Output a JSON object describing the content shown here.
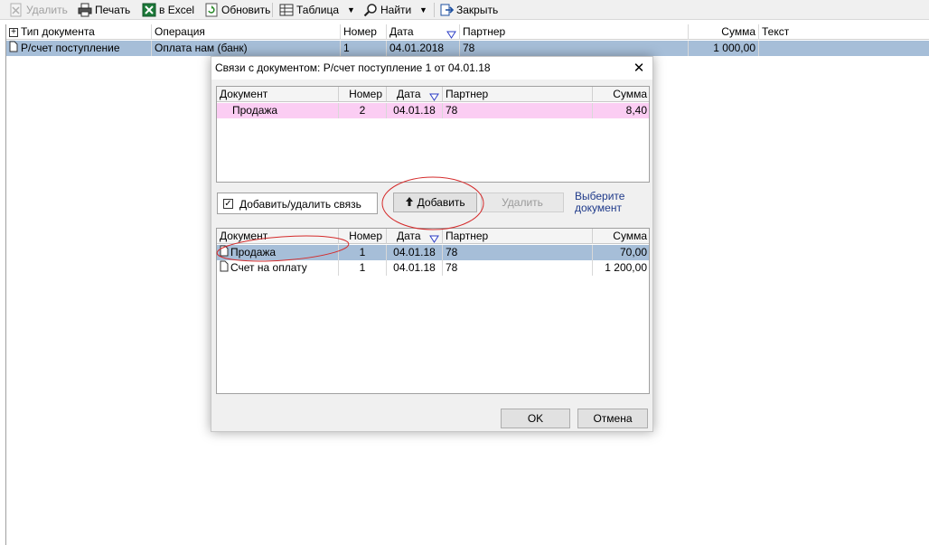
{
  "toolbar": {
    "delete_label": "Удалить",
    "print_label": "Печать",
    "excel_label": "в Excel",
    "refresh_label": "Обновить",
    "table_label": "Таблица",
    "find_label": "Найти",
    "close_label": "Закрыть"
  },
  "grid": {
    "columns": [
      "Тип документа",
      "Операция",
      "Номер",
      "Дата",
      "Партнер",
      "Сумма",
      "Текст"
    ],
    "row": {
      "type": "Р/счет поступление",
      "operation": "Оплата нам (банк)",
      "number": "1",
      "date": "04.01.2018",
      "partner": "78",
      "sum": "1 000,00",
      "text": ""
    }
  },
  "dialog": {
    "title": "Связи с документом: Р/счет поступление 1 от 04.01.18",
    "columns": [
      "Документ",
      "Номер",
      "Дата",
      "Партнер",
      "Сумма"
    ],
    "linked_rows": [
      {
        "doc": "Продажа",
        "number": "2",
        "date": "04.01.18",
        "partner": "78",
        "sum": "8,40"
      }
    ],
    "checkbox_label": "Добавить/удалить связь",
    "checkbox_checked": true,
    "add_button": "Добавить",
    "delete_button": "Удалить",
    "hint_line1": "Выберите",
    "hint_line2": "документ",
    "candidate_rows": [
      {
        "doc": "Продажа",
        "number": "1",
        "date": "04.01.18",
        "partner": "78",
        "sum": "70,00"
      },
      {
        "doc": "Счет на оплату",
        "number": "1",
        "date": "04.01.18",
        "partner": "78",
        "sum": "1 200,00"
      }
    ],
    "ok_button": "OK",
    "cancel_button": "Отмена"
  },
  "colors": {
    "selected_row": "#a6bed8",
    "linked_row": "#fbcdf3",
    "annotation": "#d42a2a",
    "hint_text": "#1f3a8a"
  }
}
